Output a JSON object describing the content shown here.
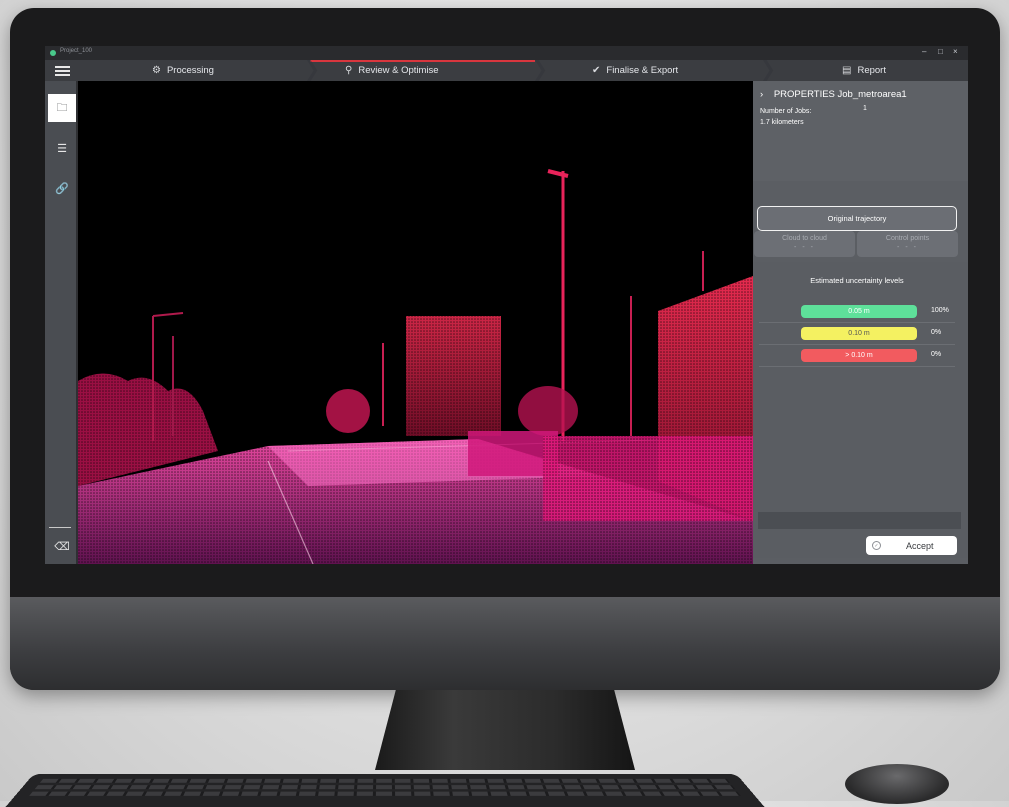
{
  "window": {
    "title": "Project_100",
    "min": "–",
    "max": "□",
    "close": "×"
  },
  "nav": {
    "steps": [
      {
        "label": "Processing",
        "icon": "gear-icon"
      },
      {
        "label": "Review & Optimise",
        "icon": "magnifier-icon",
        "active": true
      },
      {
        "label": "Finalise & Export",
        "icon": "check-icon"
      },
      {
        "label": "Report",
        "icon": "document-icon"
      }
    ]
  },
  "properties": {
    "title": "PROPERTIES Job_metroarea1",
    "rows": [
      {
        "label": "Number of Jobs:",
        "value": "1"
      },
      {
        "label": "1.7 kilometers",
        "value": ""
      }
    ]
  },
  "modes": {
    "primary": "Original trajectory",
    "secondary": [
      {
        "label": "Cloud to cloud",
        "sub": "- - -"
      },
      {
        "label": "Control points",
        "sub": "- - -"
      }
    ]
  },
  "uncertainty": {
    "title": "Estimated uncertainty levels",
    "levels": [
      {
        "label": "0.05 m",
        "percent": "100%",
        "color": "#5ee09a",
        "text_color": "#ffffff"
      },
      {
        "label": "0.10 m",
        "percent": "0%",
        "color": "#f4f161",
        "text_color": "#555555"
      },
      {
        "label": "> 0.10 m",
        "percent": "0%",
        "color": "#f25b5f",
        "text_color": "#ffffff"
      }
    ]
  },
  "actions": {
    "accept": "Accept"
  },
  "colors": {
    "accent": "#d9363e",
    "pointcloud": "#e0197a"
  }
}
